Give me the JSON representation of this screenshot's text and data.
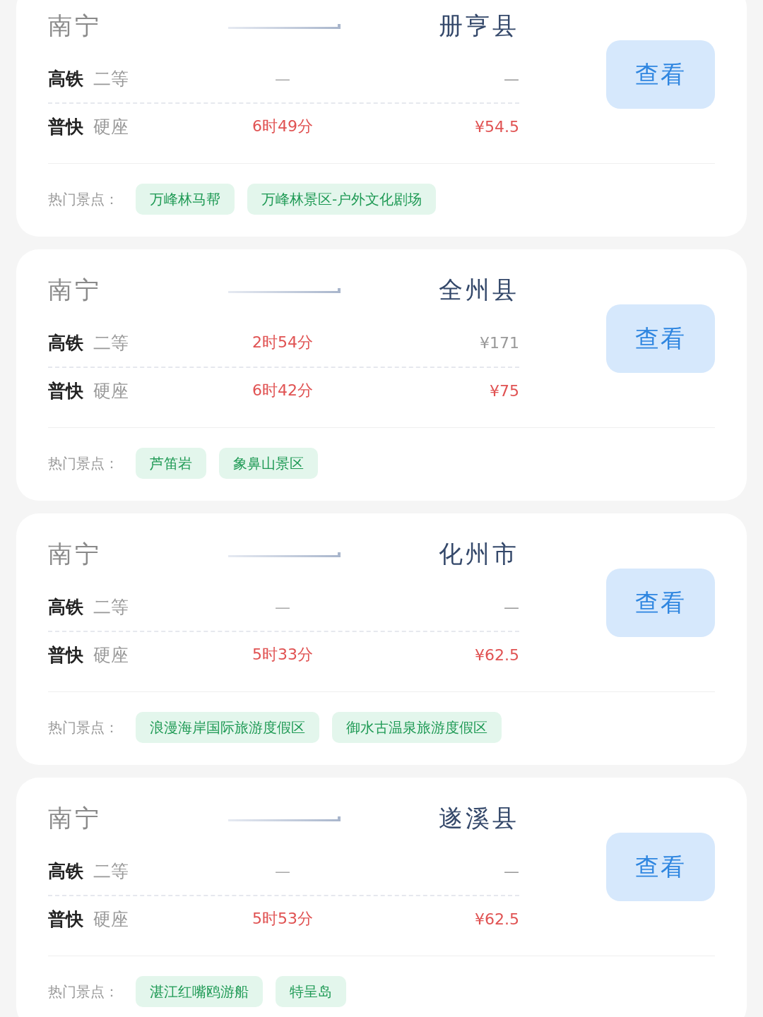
{
  "routes": [
    {
      "origin": "南宁",
      "destination": "册亨县",
      "button": "查看",
      "attractions_label": "热门景点：",
      "trains": [
        {
          "type": "高铁",
          "seat": "二等",
          "duration": "—",
          "duration_highlighted": false,
          "price": "—",
          "price_highlighted": false
        },
        {
          "type": "普快",
          "seat": "硬座",
          "duration": "6时49分",
          "duration_highlighted": true,
          "price": "¥54.5",
          "price_highlighted": true
        }
      ],
      "attractions": [
        "万峰林马帮",
        "万峰林景区-户外文化剧场"
      ]
    },
    {
      "origin": "南宁",
      "destination": "全州县",
      "button": "查看",
      "attractions_label": "热门景点：",
      "trains": [
        {
          "type": "高铁",
          "seat": "二等",
          "duration": "2时54分",
          "duration_highlighted": true,
          "price": "¥171",
          "price_highlighted": false
        },
        {
          "type": "普快",
          "seat": "硬座",
          "duration": "6时42分",
          "duration_highlighted": true,
          "price": "¥75",
          "price_highlighted": true
        }
      ],
      "attractions": [
        "芦笛岩",
        "象鼻山景区"
      ]
    },
    {
      "origin": "南宁",
      "destination": "化州市",
      "button": "查看",
      "attractions_label": "热门景点：",
      "trains": [
        {
          "type": "高铁",
          "seat": "二等",
          "duration": "—",
          "duration_highlighted": false,
          "price": "—",
          "price_highlighted": false
        },
        {
          "type": "普快",
          "seat": "硬座",
          "duration": "5时33分",
          "duration_highlighted": true,
          "price": "¥62.5",
          "price_highlighted": true
        }
      ],
      "attractions": [
        "浪漫海岸国际旅游度假区",
        "御水古温泉旅游度假区"
      ]
    },
    {
      "origin": "南宁",
      "destination": "遂溪县",
      "button": "查看",
      "attractions_label": "热门景点：",
      "trains": [
        {
          "type": "高铁",
          "seat": "二等",
          "duration": "—",
          "duration_highlighted": false,
          "price": "—",
          "price_highlighted": false
        },
        {
          "type": "普快",
          "seat": "硬座",
          "duration": "5时53分",
          "duration_highlighted": true,
          "price": "¥62.5",
          "price_highlighted": true
        }
      ],
      "attractions": [
        "湛江红嘴鸥游船",
        "特呈岛"
      ]
    }
  ]
}
